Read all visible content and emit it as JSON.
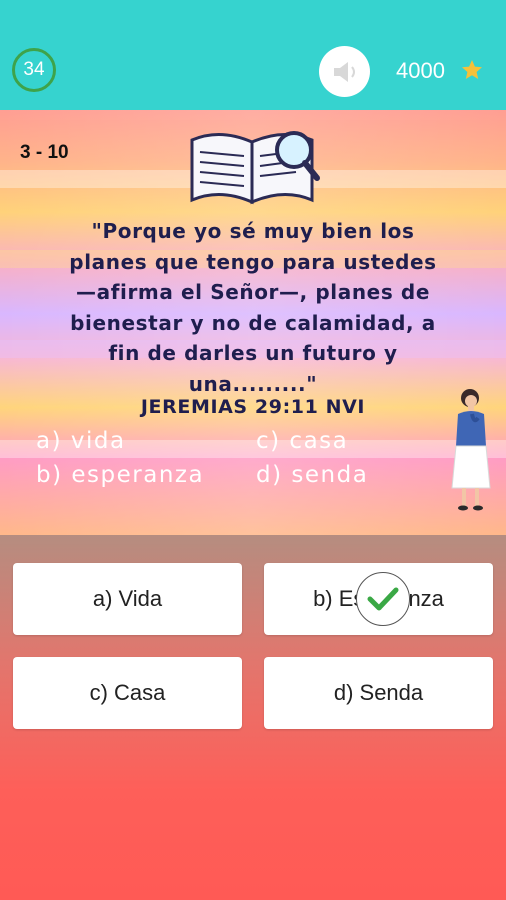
{
  "header": {
    "timer": "34",
    "score": "4000",
    "sound_icon": "speaker-muted-icon",
    "star_icon": "star-icon",
    "star_color": "#f6c13a"
  },
  "quiz": {
    "progress": "3 - 10",
    "verse_lines": [
      "\"Porque yo sé muy bien los",
      "planes que tengo para ustedes",
      "—afirma el Señor—, planes de",
      "bienestar y no de calamidad, a",
      "fin de darles un futuro y",
      "una.........\""
    ],
    "reference": "JEREMIAS 29:11 NVI",
    "options": {
      "a": "a) vida",
      "b": "b) esperanza",
      "c": "c) casa",
      "d": "d) senda"
    }
  },
  "answers": {
    "a": "a) Vida",
    "b": "b) Esperanza",
    "c": "c) Casa",
    "d": "d) Senda"
  },
  "feedback": {
    "icon": "checkmark-icon",
    "color": "#3aa845"
  }
}
